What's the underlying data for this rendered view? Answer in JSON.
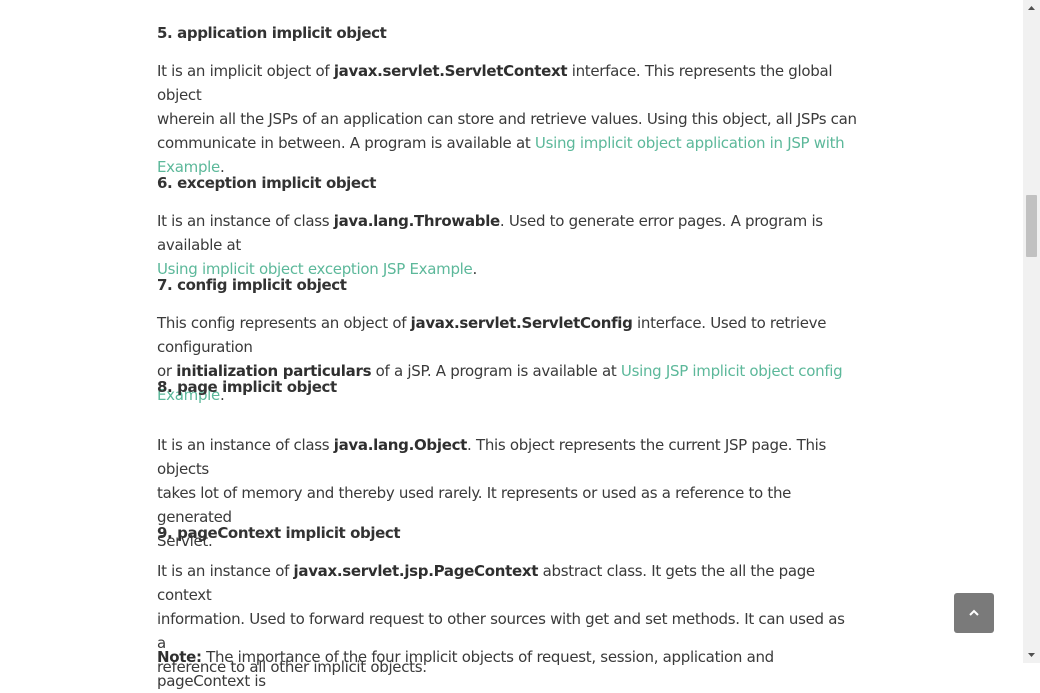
{
  "sections": [
    {
      "heading": "5. application implicit object",
      "line1_pre": "It is an implicit object of ",
      "line1_bold": "javax.servlet.ServletContext",
      "line1_post": " interface. This represents the global object",
      "line2": "wherein all the JSPs of an application can store and retrieve values. Using this object, all JSPs can",
      "line3_pre": "communicate in between. A program is available at ",
      "link_part1": "Using implicit object application in JSP with",
      "link_part2": "Example",
      "line4_post": "."
    },
    {
      "heading": "6. exception implicit object",
      "line1_pre": "It is an instance of class ",
      "line1_bold": "java.lang.Throwable",
      "line1_post": ". Used to generate error pages. A program is available at",
      "link": "Using implicit object exception JSP Example",
      "line2_post": "."
    },
    {
      "heading": "7. config implicit object",
      "line1_pre": "This config represents an object of ",
      "line1_bold": "javax.servlet.ServletConfig",
      "line1_post": " interface. Used to retrieve configuration",
      "line2_pre": "or ",
      "line2_bold": "initialization particulars",
      "line2_mid": " of a jSP. A program is available at ",
      "link": "Using JSP implicit object config Example",
      "line2_post": "."
    },
    {
      "heading": "8. page implicit object",
      "line1_pre": "It is an instance of class ",
      "line1_bold": "java.lang.Object",
      "line1_post": ". This object represents the current JSP page. This objects",
      "line2": "takes lot of memory and thereby used rarely. It represents or used as a reference to the generated",
      "line3": "Servlet."
    },
    {
      "heading": "9. pageContext implicit object",
      "line1_pre": "It is an instance of ",
      "line1_bold": "javax.servlet.jsp.PageContext",
      "line1_post": " abstract class. It gets the all the page context",
      "line2": "information. Used to forward request to other sources with get and set methods. It can used as a",
      "line3": "reference to all other implicit objects."
    }
  ],
  "note": {
    "label": "Note:",
    "text": " The importance of the four implicit objects of request, session, application and pageContext is"
  },
  "scroll_top_icon": "chevron-up-icon",
  "colors": {
    "link": "#5cb89a",
    "text": "#3a3a3a",
    "button": "#7a7a7a"
  }
}
